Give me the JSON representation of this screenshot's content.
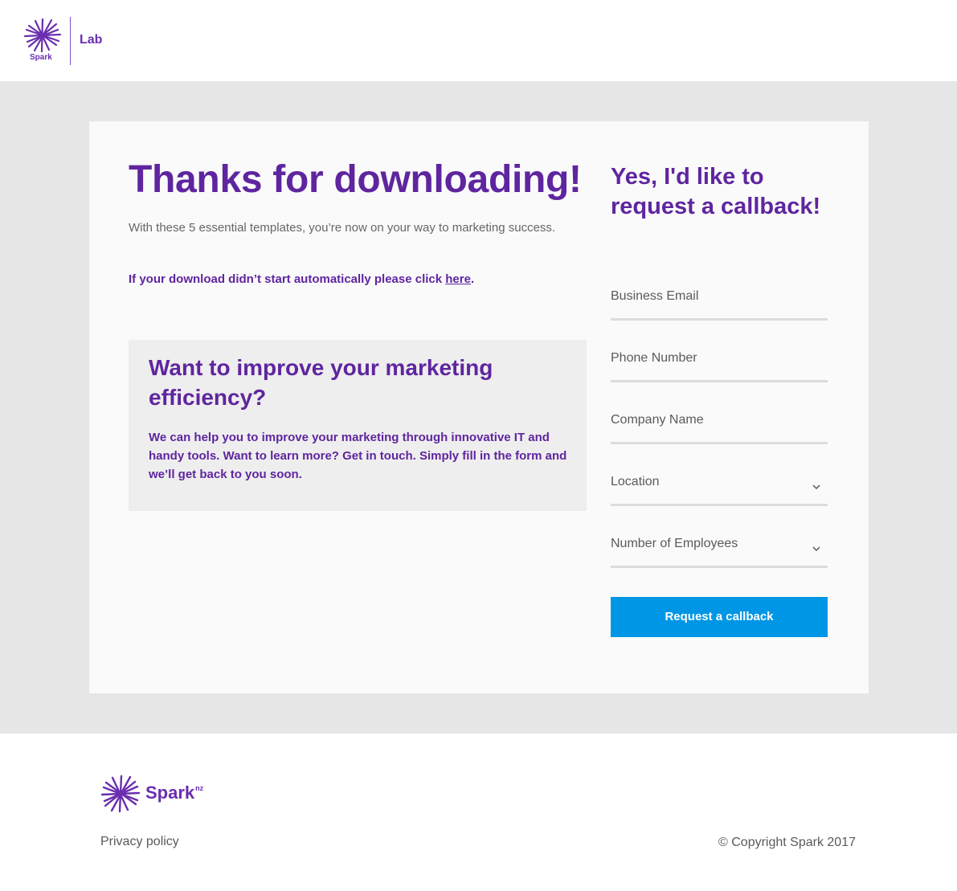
{
  "header": {
    "brand": "Spark",
    "section": "Lab"
  },
  "main": {
    "title": "Thanks for downloading!",
    "intro": "With these 5 essential templates, you’re now on your way to marketing success.",
    "download_prefix": "If your download didn’t start automatically please click ",
    "download_link": "here",
    "download_suffix": ".",
    "promo": {
      "title": "Want to improve your marketing efficiency?",
      "body": "We can help you to improve your marketing through innovative IT and handy tools. Want to learn more? Get in touch. Simply fill in the form and we’ll get back to you soon."
    }
  },
  "form": {
    "title": "Yes, I'd like to request a callback!",
    "fields": {
      "email": "Business Email",
      "phone": "Phone Number",
      "company": "Company Name",
      "location": "Location",
      "employees": "Number of Employees"
    },
    "submit_label": "Request a callback"
  },
  "footer": {
    "brand": "Spark",
    "brand_suffix": "nz",
    "privacy": "Privacy policy",
    "copyright": "© Copyright Spark 2017"
  },
  "colors": {
    "brand_purple": "#5f259f",
    "button_blue": "#0096e6",
    "band_gray": "#e6e6e6"
  },
  "icons": [
    "spark-logo-icon",
    "chevron-down-icon"
  ]
}
